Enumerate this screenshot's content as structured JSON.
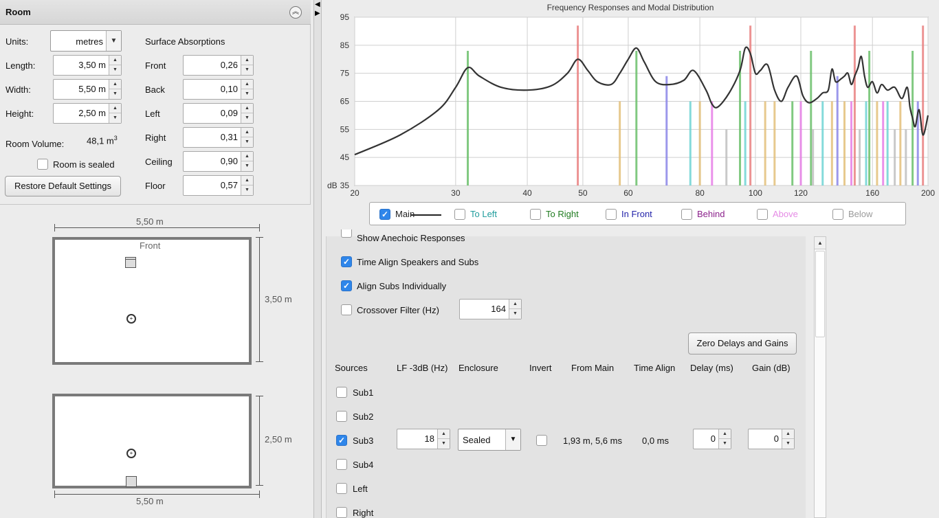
{
  "room": {
    "title": "Room",
    "units_label": "Units:",
    "units_value": "metres",
    "length_label": "Length:",
    "length_value": "3,50 m",
    "width_label": "Width:",
    "width_value": "5,50 m",
    "height_label": "Height:",
    "height_value": "2,50 m",
    "volume_label": "Room Volume:",
    "volume_value": "48,1 m",
    "volume_unit_sup": "3",
    "sealed_label": "Room is sealed",
    "restore_button": "Restore Default Settings",
    "absorptions_title": "Surface Absorptions",
    "surfaces": [
      {
        "label": "Front",
        "value": "0,26"
      },
      {
        "label": "Back",
        "value": "0,10"
      },
      {
        "label": "Left",
        "value": "0,09"
      },
      {
        "label": "Right",
        "value": "0,31"
      },
      {
        "label": "Ceiling",
        "value": "0,90"
      },
      {
        "label": "Floor",
        "value": "0,57"
      }
    ]
  },
  "plan": {
    "top_view": {
      "width_top": "5,50 m",
      "front_label": "Front",
      "depth_right": "3,50 m"
    },
    "side_view": {
      "height_right": "2,50 m",
      "width_bottom": "5,50 m"
    }
  },
  "chart_data": {
    "type": "line",
    "title": "Frequency Responses and Modal Distribution",
    "xscale": "log",
    "xlim": [
      20,
      200
    ],
    "ylim": [
      35,
      95
    ],
    "x_ticks": [
      "20",
      "30",
      "40",
      "50",
      "60",
      "80",
      "100",
      "120",
      "160",
      "200"
    ],
    "y_ticks": [
      "95",
      "85",
      "75",
      "65",
      "55",
      "45",
      "35"
    ],
    "y_unit": "dB",
    "grid": true,
    "series": [
      {
        "name": "Main",
        "x": [
          20,
          24,
          28,
          30,
          31.5,
          33,
          36,
          40,
          44,
          47,
          49,
          51,
          53,
          56,
          58,
          60,
          62,
          64,
          67,
          71,
          75,
          78,
          82,
          84,
          86,
          90,
          94,
          96,
          98,
          100,
          102,
          105,
          108,
          111,
          114,
          118,
          121,
          124,
          128,
          131,
          134,
          136,
          138,
          141,
          143,
          145,
          147,
          149,
          151,
          153,
          155,
          157,
          160,
          163,
          166,
          170,
          175,
          180,
          184,
          186,
          188,
          190,
          193,
          196,
          200
        ],
        "y": [
          46,
          53,
          62,
          70,
          77,
          74,
          70,
          69,
          70.5,
          75,
          80,
          76,
          72,
          71,
          75,
          80,
          84,
          79,
          72,
          71,
          72.5,
          76,
          69,
          64,
          63,
          68,
          76,
          84,
          82,
          75,
          76,
          78,
          69,
          65,
          70,
          74,
          67,
          64.5,
          66,
          68,
          69,
          76.5,
          72,
          73,
          74,
          75,
          71,
          74,
          77,
          81,
          74,
          70,
          72,
          68,
          71,
          69,
          70,
          66,
          70,
          63,
          59,
          56,
          62,
          53,
          60
        ]
      }
    ],
    "modal_lines": [
      {
        "x": 31.5,
        "top": 83,
        "color": "#6bbf6b"
      },
      {
        "x": 49,
        "top": 92,
        "color": "#e98080"
      },
      {
        "x": 58,
        "top": 65,
        "color": "#e3c07a"
      },
      {
        "x": 62,
        "top": 83,
        "color": "#6bbf6b"
      },
      {
        "x": 70,
        "top": 74,
        "color": "#8b86e8"
      },
      {
        "x": 77,
        "top": 65,
        "color": "#6fd3d3"
      },
      {
        "x": 80,
        "top": 65,
        "color": "#e3c07a"
      },
      {
        "x": 84,
        "top": 65,
        "color": "#e67ee6"
      },
      {
        "x": 89,
        "top": 55,
        "color": "#bfbfbf"
      },
      {
        "x": 94,
        "top": 83,
        "color": "#6bbf6b"
      },
      {
        "x": 96,
        "top": 65,
        "color": "#6fd3d3"
      },
      {
        "x": 98,
        "top": 92,
        "color": "#e98080"
      },
      {
        "x": 104,
        "top": 65,
        "color": "#e3c07a"
      },
      {
        "x": 108,
        "top": 65,
        "color": "#e3c07a"
      },
      {
        "x": 116,
        "top": 65,
        "color": "#6bbf6b"
      },
      {
        "x": 120,
        "top": 65,
        "color": "#e67ee6"
      },
      {
        "x": 125,
        "top": 83,
        "color": "#6bbf6b"
      },
      {
        "x": 126,
        "top": 55,
        "color": "#bfbfbf"
      },
      {
        "x": 131,
        "top": 65,
        "color": "#6fd3d3"
      },
      {
        "x": 136,
        "top": 65,
        "color": "#e3c07a"
      },
      {
        "x": 139,
        "top": 74,
        "color": "#8b86e8"
      },
      {
        "x": 143,
        "top": 65,
        "color": "#e3c07a"
      },
      {
        "x": 147,
        "top": 65,
        "color": "#e67ee6"
      },
      {
        "x": 149,
        "top": 92,
        "color": "#e98080"
      },
      {
        "x": 152,
        "top": 55,
        "color": "#bfbfbf"
      },
      {
        "x": 156,
        "top": 65,
        "color": "#6fd3d3"
      },
      {
        "x": 158,
        "top": 83,
        "color": "#6bbf6b"
      },
      {
        "x": 163,
        "top": 65,
        "color": "#e3c07a"
      },
      {
        "x": 167,
        "top": 65,
        "color": "#e67ee6"
      },
      {
        "x": 170,
        "top": 65,
        "color": "#6fd3d3"
      },
      {
        "x": 175,
        "top": 55,
        "color": "#bfbfbf"
      },
      {
        "x": 179,
        "top": 65,
        "color": "#e3c07a"
      },
      {
        "x": 183,
        "top": 55,
        "color": "#bfbfbf"
      },
      {
        "x": 188,
        "top": 83,
        "color": "#6bbf6b"
      },
      {
        "x": 192,
        "top": 65,
        "color": "#8b86e8"
      },
      {
        "x": 196,
        "top": 92,
        "color": "#e98080"
      }
    ],
    "legend": [
      {
        "label": "Main",
        "checked": true,
        "color": "#222222"
      },
      {
        "label": "To Left",
        "checked": false,
        "color": "#1f9c9c"
      },
      {
        "label": "To Right",
        "checked": false,
        "color": "#1e7a1e"
      },
      {
        "label": "In Front",
        "checked": false,
        "color": "#1f1fa8"
      },
      {
        "label": "Behind",
        "checked": false,
        "color": "#8a1f8a"
      },
      {
        "label": "Above",
        "checked": false,
        "color": "#e58be5"
      },
      {
        "label": "Below",
        "checked": false,
        "color": "#9a9a9a"
      }
    ]
  },
  "options": {
    "anechoic_label": "Show Anechoic Responses",
    "time_align_label": "Time Align Speakers and Subs",
    "align_subs_label": "Align Subs Individually",
    "crossover_label": "Crossover Filter (Hz)",
    "crossover_value": "164",
    "zero_button": "Zero Delays and Gains"
  },
  "table": {
    "headers": [
      "Sources",
      "LF -3dB (Hz)",
      "Enclosure",
      "Invert",
      "From Main",
      "Time Align",
      "Delay (ms)",
      "Gain (dB)"
    ],
    "rows": [
      {
        "name": "Sub1",
        "checked": false
      },
      {
        "name": "Sub2",
        "checked": false
      },
      {
        "name": "Sub3",
        "checked": true,
        "lf": "18",
        "enclosure": "Sealed",
        "from_main": "1,93 m, 5,6 ms",
        "time_align": "0,0 ms",
        "delay": "0",
        "gain": "0"
      },
      {
        "name": "Sub4",
        "checked": false
      },
      {
        "name": "Left",
        "checked": false
      },
      {
        "name": "Right",
        "checked": false
      }
    ]
  }
}
